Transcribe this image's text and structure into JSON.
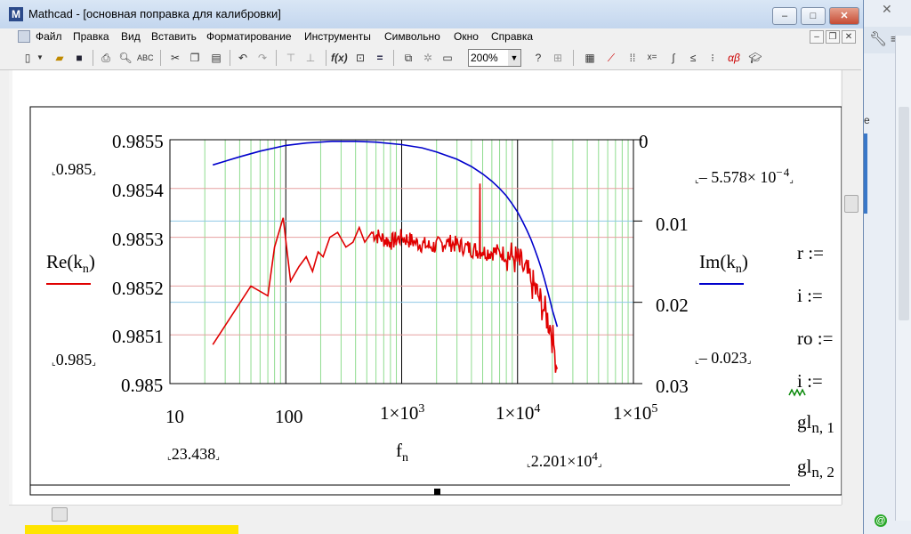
{
  "window": {
    "title": "Mathcad - [основная поправка для калибровки]",
    "app_icon": "mathcad-icon"
  },
  "menu": [
    {
      "label": "Файл"
    },
    {
      "label": "Правка"
    },
    {
      "label": "Вид"
    },
    {
      "label": "Вставить"
    },
    {
      "label": "Форматирование"
    },
    {
      "label": "Инструменты"
    },
    {
      "label": "Символьно"
    },
    {
      "label": "Окно"
    },
    {
      "label": "Справка"
    }
  ],
  "toolbar": {
    "zoom": "200%",
    "icons": [
      "new-icon",
      "open-icon",
      "save-icon",
      "print-icon",
      "print-preview-icon",
      "spell-check-icon",
      "cut-icon",
      "copy-icon",
      "paste-icon",
      "undo-icon",
      "redo-icon",
      "align-top-icon",
      "align-down-icon",
      "insert-function-icon",
      "insert-unit-icon",
      "calculate-icon",
      "component-icon",
      "resource-icon",
      "region-icon",
      "help-icon",
      "resource-center-icon",
      "calculator-icon",
      "graph-icon",
      "matrix-icon",
      "evaluation-icon",
      "calculus-icon",
      "boolean-icon",
      "programming-icon",
      "greek-icon",
      "symbolic-icon"
    ]
  },
  "plot": {
    "left_axis": {
      "ticks": [
        "0.9855",
        "0.9854",
        "0.9853",
        "0.9852",
        "0.9851",
        "0.985"
      ],
      "top_limit": "0.985",
      "bottom_limit": "0.985"
    },
    "right_axis": {
      "ticks": [
        "0",
        "0.01",
        "0.02",
        "0.03"
      ],
      "top_limit_prefix": "5.578",
      "top_limit_exp": "4",
      "bottom_limit": "0.023"
    },
    "x_axis": {
      "ticks": [
        {
          "text": "10",
          "exp": ""
        },
        {
          "text": "100",
          "exp": ""
        },
        {
          "text": "1×10",
          "exp": "3"
        },
        {
          "text": "1×10",
          "exp": "4"
        },
        {
          "text": "1×10",
          "exp": "5"
        }
      ],
      "left_limit": "23.438",
      "right_limit_prefix": "2.201×10",
      "right_limit_exp": "4",
      "label_var": "f",
      "label_sub": "n"
    },
    "left_trace": {
      "fn": "Re",
      "arg": "k",
      "arg_sub": "n",
      "color": "#e00000"
    },
    "right_trace": {
      "fn": "Im",
      "arg": "k",
      "arg_sub": "n",
      "color": "#0000cc"
    }
  },
  "chart_data": {
    "type": "line",
    "title": "",
    "xlabel": "f_n",
    "x_scale": "log",
    "xlim": [
      10,
      100000
    ],
    "ylim_left": [
      0.985,
      0.9855
    ],
    "ylim_right": [
      -0.03,
      0
    ],
    "series": [
      {
        "name": "Re(k_n)",
        "axis": "left",
        "color": "#e00000",
        "x": [
          23.438,
          50,
          70,
          80,
          95,
          110,
          130,
          150,
          170,
          190,
          210,
          240,
          280,
          330,
          380,
          430,
          480,
          550,
          650,
          800,
          1000,
          1300,
          1800,
          2500,
          3500,
          5000,
          7000,
          9000,
          11000,
          13000,
          15000,
          17000,
          19000,
          20500,
          22010
        ],
        "y": [
          0.98508,
          0.9852,
          0.98518,
          0.98528,
          0.98534,
          0.98521,
          0.98524,
          0.98526,
          0.98523,
          0.98527,
          0.98526,
          0.9853,
          0.98531,
          0.98528,
          0.98529,
          0.98532,
          0.98529,
          0.98531,
          0.9853,
          0.98529,
          0.9853,
          0.98529,
          0.98528,
          0.98529,
          0.98528,
          0.98527,
          0.98527,
          0.98526,
          0.98524,
          0.98521,
          0.98518,
          0.98515,
          0.98512,
          0.98508,
          0.98503
        ]
      },
      {
        "name": "Im(k_n)",
        "axis": "right",
        "color": "#0000cc",
        "x": [
          23.438,
          40,
          60,
          100,
          150,
          250,
          400,
          600,
          1000,
          1500,
          2000,
          3000,
          4000,
          5000,
          6000,
          7000,
          8000,
          9000,
          10000,
          11000,
          12000,
          13000,
          14000,
          15000,
          16000,
          17000,
          18000,
          19000,
          20000,
          21000,
          22010
        ],
        "y": [
          -0.0031,
          -0.0021,
          -0.0014,
          -0.0007,
          -0.0004,
          -0.0002,
          -0.0002,
          -0.0003,
          -0.0006,
          -0.001,
          -0.0015,
          -0.0024,
          -0.0033,
          -0.0042,
          -0.0051,
          -0.006,
          -0.0069,
          -0.0079,
          -0.0089,
          -0.01,
          -0.0111,
          -0.0122,
          -0.0134,
          -0.0146,
          -0.0158,
          -0.0171,
          -0.0184,
          -0.0197,
          -0.021,
          -0.022,
          -0.023
        ]
      }
    ]
  },
  "right_definitions": [
    {
      "text": "r :="
    },
    {
      "text": "i :="
    },
    {
      "text": "ro :="
    },
    {
      "text": "i :="
    },
    {
      "text": "gl",
      "sub": "n, 1"
    },
    {
      "text": "gl",
      "sub": "n, 2"
    }
  ]
}
